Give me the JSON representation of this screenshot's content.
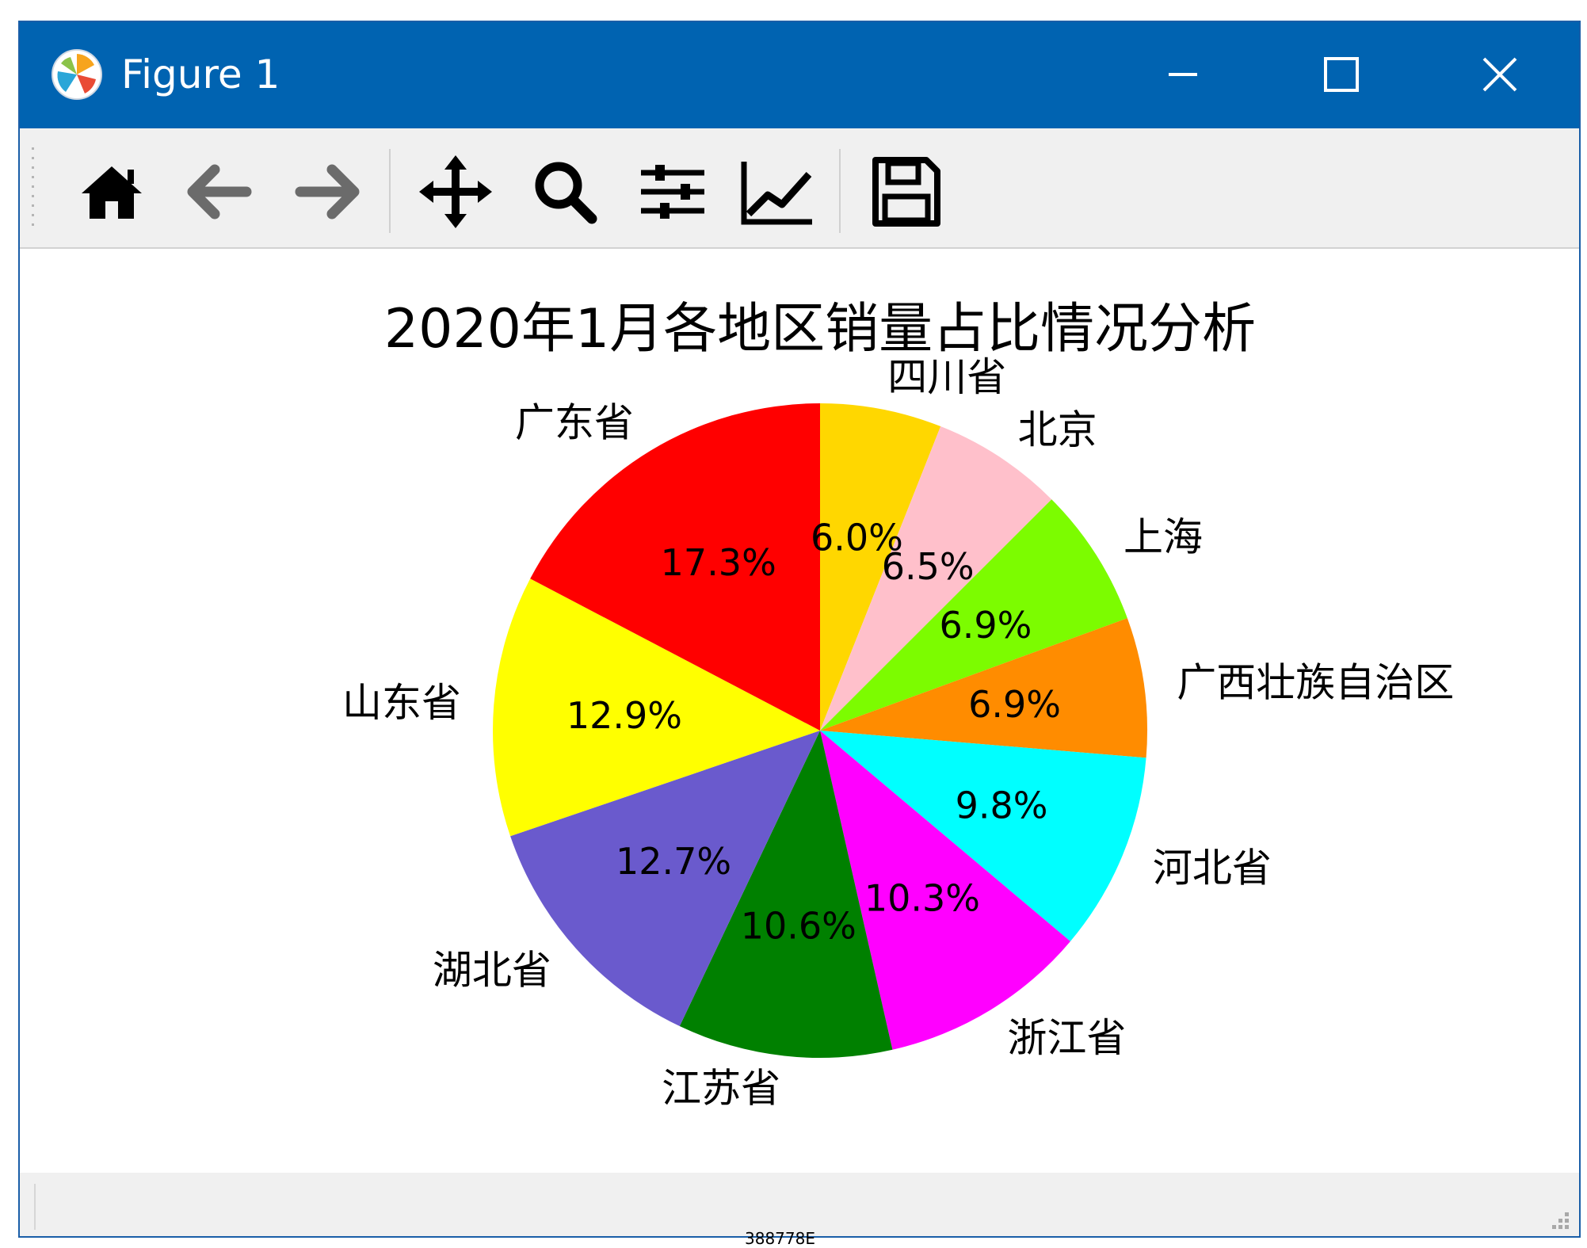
{
  "window": {
    "title": "Figure 1"
  },
  "toolbar": {
    "tools": [
      {
        "name": "home-icon"
      },
      {
        "name": "back-arrow-icon"
      },
      {
        "name": "forward-arrow-icon"
      },
      {
        "name": "pan-move-icon"
      },
      {
        "name": "zoom-magnifier-icon"
      },
      {
        "name": "configure-subplots-icon"
      },
      {
        "name": "edit-axis-icon"
      },
      {
        "name": "save-floppy-icon"
      }
    ]
  },
  "status": {
    "text": ""
  },
  "caption": "388778E",
  "colors": {
    "titlebar": "#0063b1",
    "toolbar": "#f0f0f0"
  },
  "chart_data": {
    "type": "pie",
    "title": "2020年1月各地区销量占比情况分析",
    "start_angle_deg": 90,
    "direction": "clockwise",
    "slices": [
      {
        "label": "四川省",
        "percent": 6.0,
        "pct_label": "6.0%",
        "color": "#ffd700"
      },
      {
        "label": "北京",
        "percent": 6.5,
        "pct_label": "6.5%",
        "color": "#ffc0cb"
      },
      {
        "label": "上海",
        "percent": 6.9,
        "pct_label": "6.9%",
        "color": "#7cfc00"
      },
      {
        "label": "广西壮族自治区",
        "percent": 6.9,
        "pct_label": "6.9%",
        "color": "#ff8c00"
      },
      {
        "label": "河北省",
        "percent": 9.8,
        "pct_label": "9.8%",
        "color": "#00ffff"
      },
      {
        "label": "浙江省",
        "percent": 10.3,
        "pct_label": "10.3%",
        "color": "#ff00ff"
      },
      {
        "label": "江苏省",
        "percent": 10.6,
        "pct_label": "10.6%",
        "color": "#008000"
      },
      {
        "label": "湖北省",
        "percent": 12.7,
        "pct_label": "12.7%",
        "color": "#6a5acd"
      },
      {
        "label": "山东省",
        "percent": 12.9,
        "pct_label": "12.9%",
        "color": "#ffff00"
      },
      {
        "label": "广东省",
        "percent": 17.3,
        "pct_label": "17.3%",
        "color": "#ff0000"
      }
    ]
  }
}
